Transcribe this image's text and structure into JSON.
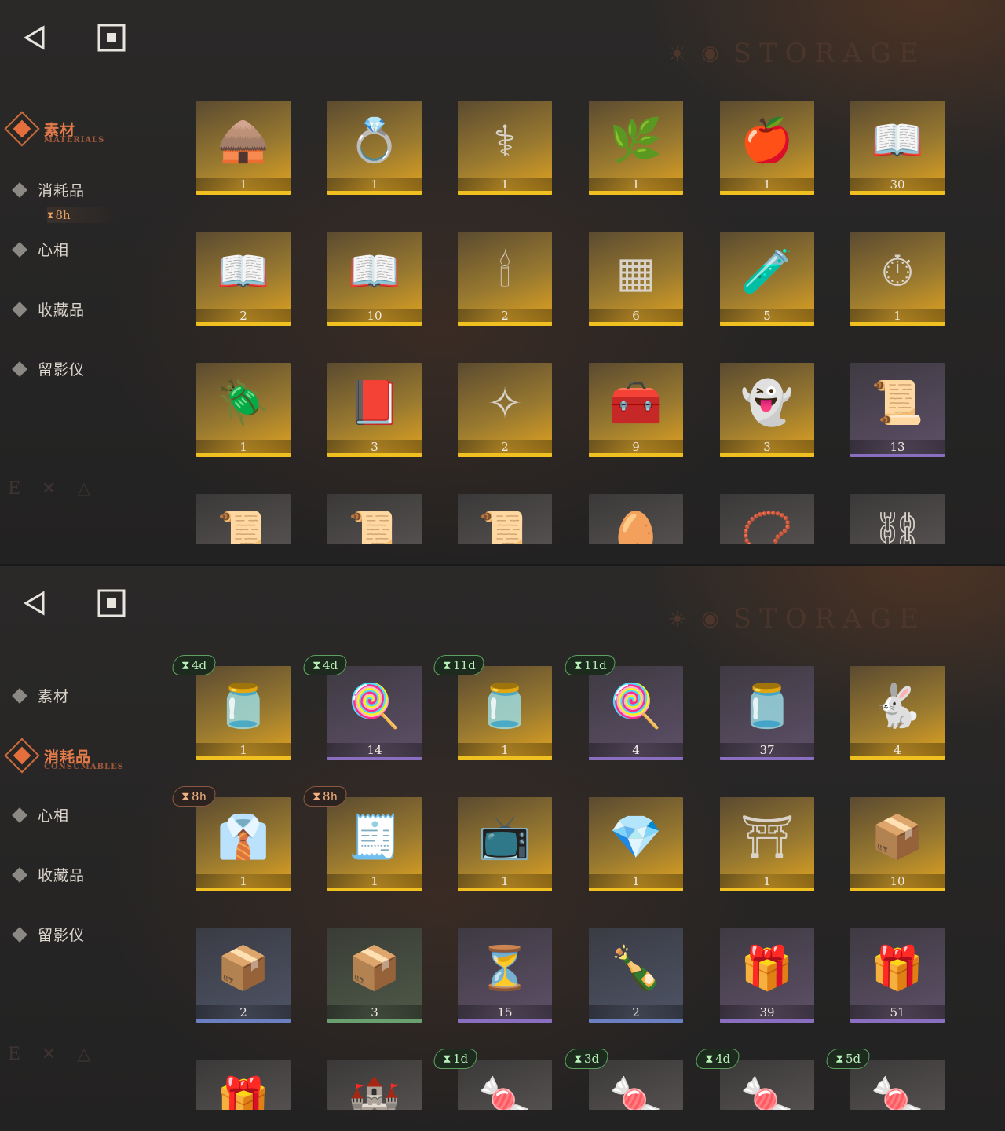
{
  "top": {
    "nav": {
      "back_icon": "back-triangle-icon",
      "home_icon": "square-home-icon"
    },
    "header": {
      "title": "STORAGE"
    },
    "sidebar": {
      "items": [
        {
          "label": "素材",
          "sub": "MATERIALS",
          "active": true
        },
        {
          "label": "消耗品",
          "sub": "",
          "active": false,
          "timer": "8h"
        },
        {
          "label": "心相",
          "sub": "",
          "active": false
        },
        {
          "label": "收藏品",
          "sub": "",
          "active": false
        },
        {
          "label": "留影仪",
          "sub": "",
          "active": false
        }
      ]
    },
    "items": [
      {
        "icon": "hut-icon",
        "glyph": "🛖",
        "count": "1",
        "rarity": "gold"
      },
      {
        "icon": "ring-icon",
        "glyph": "💍",
        "count": "1",
        "rarity": "gold"
      },
      {
        "icon": "caduceus-icon",
        "glyph": "⚕",
        "count": "1",
        "rarity": "gold"
      },
      {
        "icon": "laurel-icon",
        "glyph": "🌿",
        "count": "1",
        "rarity": "gold"
      },
      {
        "icon": "apple-snake-icon",
        "glyph": "🍎",
        "count": "1",
        "rarity": "gold"
      },
      {
        "icon": "book-icon",
        "glyph": "📖",
        "count": "30",
        "rarity": "gold"
      },
      {
        "icon": "book-blue-icon",
        "glyph": "📖",
        "count": "2",
        "rarity": "gold"
      },
      {
        "icon": "book-gold-icon",
        "glyph": "📖",
        "count": "10",
        "rarity": "gold"
      },
      {
        "icon": "ouija-board-icon",
        "glyph": "🕯",
        "count": "2",
        "rarity": "gold"
      },
      {
        "icon": "green-tablet-icon",
        "glyph": "▦",
        "count": "6",
        "rarity": "gold"
      },
      {
        "icon": "potion-bottle-icon",
        "glyph": "🧪",
        "count": "5",
        "rarity": "gold"
      },
      {
        "icon": "pocket-watch-icon",
        "glyph": "⏱",
        "count": "1",
        "rarity": "gold"
      },
      {
        "icon": "firefly-icon",
        "glyph": "🪲",
        "count": "1",
        "rarity": "gold"
      },
      {
        "icon": "dark-tome-icon",
        "glyph": "📕",
        "count": "3",
        "rarity": "gold"
      },
      {
        "icon": "bullets-icon",
        "glyph": "✧",
        "count": "2",
        "rarity": "gold"
      },
      {
        "icon": "hand-box-icon",
        "glyph": "🧰",
        "count": "9",
        "rarity": "gold"
      },
      {
        "icon": "ghost-icon",
        "glyph": "👻",
        "count": "3",
        "rarity": "gold"
      },
      {
        "icon": "scroll-red-icon",
        "glyph": "📜",
        "count": "13",
        "rarity": "purple"
      },
      {
        "icon": "scroll-green-icon",
        "glyph": "📜",
        "count": "",
        "rarity": "gray"
      },
      {
        "icon": "scroll-blue-icon",
        "glyph": "📜",
        "count": "",
        "rarity": "gray"
      },
      {
        "icon": "scroll-gold-icon",
        "glyph": "📜",
        "count": "",
        "rarity": "gray"
      },
      {
        "icon": "egg-icon",
        "glyph": "🥚",
        "count": "",
        "rarity": "gray"
      },
      {
        "icon": "amulet-icon",
        "glyph": "📿",
        "count": "",
        "rarity": "gray"
      },
      {
        "icon": "chain-icon",
        "glyph": "⛓",
        "count": "",
        "rarity": "gray"
      }
    ]
  },
  "bottom": {
    "nav": {
      "back_icon": "back-triangle-icon",
      "home_icon": "square-home-icon"
    },
    "header": {
      "title": "STORAGE"
    },
    "sidebar": {
      "items": [
        {
          "label": "素材",
          "sub": "",
          "active": false
        },
        {
          "label": "消耗品",
          "sub": "CONSUMABLES",
          "active": true
        },
        {
          "label": "心相",
          "sub": "",
          "active": false
        },
        {
          "label": "收藏品",
          "sub": "",
          "active": false
        },
        {
          "label": "留影仪",
          "sub": "",
          "active": false
        }
      ]
    },
    "items": [
      {
        "icon": "candy-jar-icon",
        "glyph": "🫙",
        "count": "1",
        "rarity": "gold",
        "badge": "4d",
        "badge_color": "green"
      },
      {
        "icon": "lollipop-icon",
        "glyph": "🍭",
        "count": "14",
        "rarity": "purple",
        "badge": "4d",
        "badge_color": "green"
      },
      {
        "icon": "candy-jar-icon",
        "glyph": "🫙",
        "count": "1",
        "rarity": "gold",
        "badge": "11d",
        "badge_color": "green"
      },
      {
        "icon": "lollipop-icon",
        "glyph": "🍭",
        "count": "4",
        "rarity": "purple",
        "badge": "11d",
        "badge_color": "green"
      },
      {
        "icon": "candy-jar-icon",
        "glyph": "🫙",
        "count": "37",
        "rarity": "purple"
      },
      {
        "icon": "rabbit-box-icon",
        "glyph": "🐇",
        "count": "4",
        "rarity": "gold"
      },
      {
        "icon": "mannequin-icon",
        "glyph": "👔",
        "count": "1",
        "rarity": "gold",
        "badge": "8h",
        "badge_color": "orange"
      },
      {
        "icon": "shopping-list-icon",
        "glyph": "🧾",
        "count": "1",
        "rarity": "gold",
        "badge": "8h",
        "badge_color": "orange"
      },
      {
        "icon": "old-tv-icon",
        "glyph": "📺",
        "count": "1",
        "rarity": "gold"
      },
      {
        "icon": "crystal-icon",
        "glyph": "💎",
        "count": "1",
        "rarity": "gold"
      },
      {
        "icon": "rune-table-icon",
        "glyph": "⛩",
        "count": "1",
        "rarity": "gold"
      },
      {
        "icon": "crate-gold-icon",
        "glyph": "📦",
        "count": "10",
        "rarity": "gold"
      },
      {
        "icon": "crate-blue-icon",
        "glyph": "📦",
        "count": "2",
        "rarity": "blue"
      },
      {
        "icon": "crate-green-icon",
        "glyph": "📦",
        "count": "3",
        "rarity": "green"
      },
      {
        "icon": "hourglass-icon",
        "glyph": "⏳",
        "count": "15",
        "rarity": "purple"
      },
      {
        "icon": "message-bottle-icon",
        "glyph": "🍾",
        "count": "2",
        "rarity": "blue"
      },
      {
        "icon": "parcel-icon",
        "glyph": "🎁",
        "count": "39",
        "rarity": "purple"
      },
      {
        "icon": "parcel-icon",
        "glyph": "🎁",
        "count": "51",
        "rarity": "purple"
      },
      {
        "icon": "parcel-icon",
        "glyph": "🎁",
        "count": "",
        "rarity": "gray"
      },
      {
        "icon": "sandcastle-icon",
        "glyph": "🏰",
        "count": "",
        "rarity": "gray"
      },
      {
        "icon": "candies-icon",
        "glyph": "🍬",
        "count": "",
        "rarity": "gray",
        "badge": "1d",
        "badge_color": "green"
      },
      {
        "icon": "candies-icon",
        "glyph": "🍬",
        "count": "",
        "rarity": "gray",
        "badge": "3d",
        "badge_color": "green"
      },
      {
        "icon": "candies-icon",
        "glyph": "🍬",
        "count": "",
        "rarity": "gray",
        "badge": "4d",
        "badge_color": "green"
      },
      {
        "icon": "candies-icon",
        "glyph": "🍬",
        "count": "",
        "rarity": "gray",
        "badge": "5d",
        "badge_color": "green"
      }
    ]
  }
}
